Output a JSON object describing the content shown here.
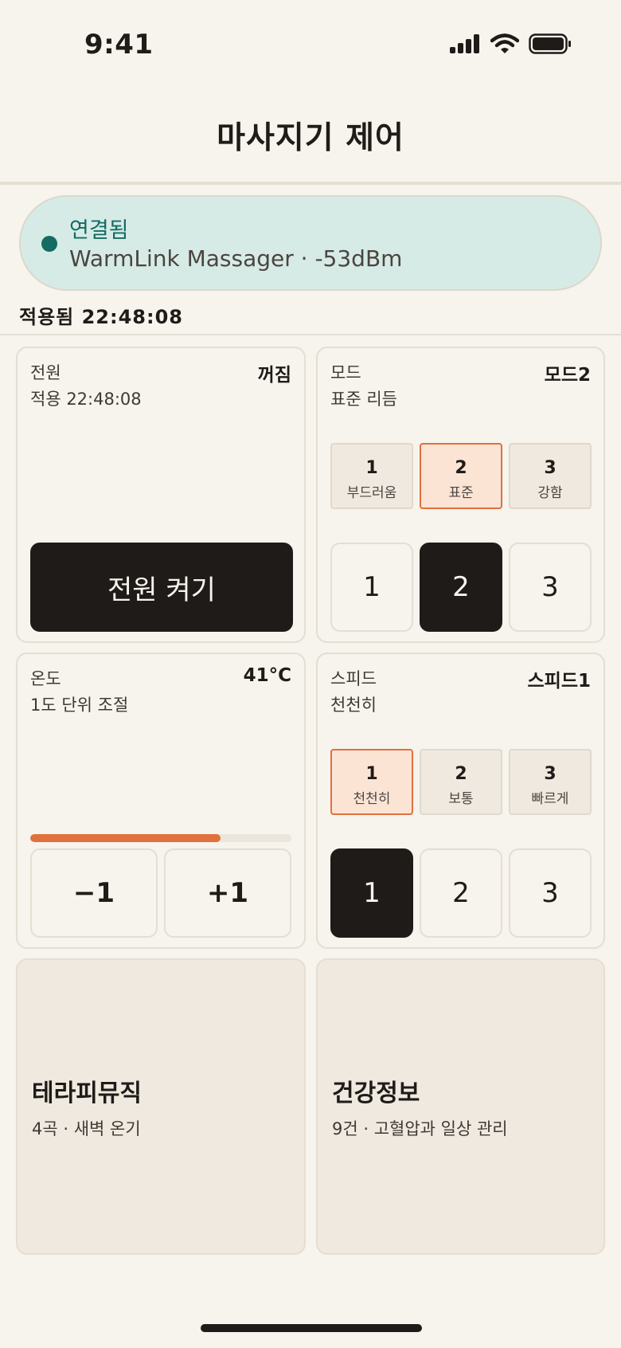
{
  "status_bar": {
    "time": "9:41"
  },
  "header": {
    "title": "마사지기 제어"
  },
  "connection": {
    "status": "연결됨",
    "device": "WarmLink Massager · -53dBm",
    "applied": "적용됨 22:48:08"
  },
  "power": {
    "label": "전원",
    "sub": "적용 22:48:08",
    "value": "꺼짐",
    "button_label": "전원 켜기"
  },
  "mode": {
    "label": "모드",
    "sub": "표준 리듬",
    "value": "모드2",
    "presets": [
      {
        "num": "1",
        "name": "부드러움",
        "active": false
      },
      {
        "num": "2",
        "name": "표준",
        "active": true
      },
      {
        "num": "3",
        "name": "강함",
        "active": false
      }
    ],
    "numbers": [
      "1",
      "2",
      "3"
    ],
    "selected_number": "2"
  },
  "temperature": {
    "label": "온도",
    "sub": "1도 단위 조절",
    "value": "41°C",
    "level_fraction": 0.73,
    "minus_label": "−1",
    "plus_label": "+1"
  },
  "speed": {
    "label": "스피드",
    "sub": "천천히",
    "value": "스피드1",
    "presets": [
      {
        "num": "1",
        "name": "천천히",
        "active": true
      },
      {
        "num": "2",
        "name": "보통",
        "active": false
      },
      {
        "num": "3",
        "name": "빠르게",
        "active": false
      }
    ],
    "numbers": [
      "1",
      "2",
      "3"
    ],
    "selected_number": "1"
  },
  "links": {
    "music": {
      "title": "테라피뮤직",
      "sub": "4곡 · 새벽 온기"
    },
    "health": {
      "title": "건강정보",
      "sub": "9건 · 고혈압과 일상 관리"
    }
  },
  "colors": {
    "background": "#f7f3ed",
    "connected_bg": "#d7ebe6",
    "connected_text": "#146b64",
    "accent": "#e0703c",
    "accent_bg": "#fce4d5",
    "dark": "#1f1b18"
  },
  "icons": [
    "signal-icon",
    "wifi-icon",
    "battery-icon"
  ]
}
